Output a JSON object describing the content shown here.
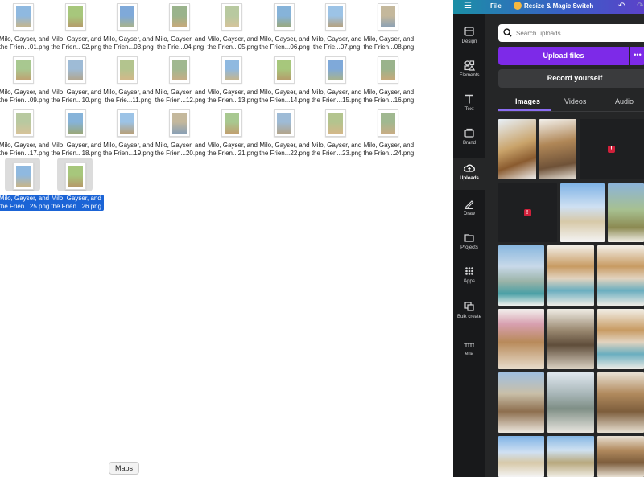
{
  "finder": {
    "files": [
      {
        "line1": "Milo, Gayser, and",
        "line2": "the Frien...01.png",
        "selected": false
      },
      {
        "line1": "Milo, Gayser, and",
        "line2": "the Frien...02.png",
        "selected": false
      },
      {
        "line1": "Milo, Gayser, and",
        "line2": "the Frien...03.png",
        "selected": false
      },
      {
        "line1": "Milo, Gayser, and",
        "line2": "the Frie...04.png",
        "selected": false
      },
      {
        "line1": "Milo, Gayser, and",
        "line2": "the Frien...05.png",
        "selected": false
      },
      {
        "line1": "Milo, Gayser, and",
        "line2": "the Frien...06.png",
        "selected": false
      },
      {
        "line1": "Milo, Gayser, and",
        "line2": "the Frie...07.png",
        "selected": false
      },
      {
        "line1": "Milo, Gayser, and",
        "line2": "the Frien...08.png",
        "selected": false
      },
      {
        "line1": "Milo, Gayser, and",
        "line2": "the Frien...09.png",
        "selected": false
      },
      {
        "line1": "Milo, Gayser, and",
        "line2": "the Frien...10.png",
        "selected": false
      },
      {
        "line1": "Milo, Gayser, and",
        "line2": "the Frie...11.png",
        "selected": false
      },
      {
        "line1": "Milo, Gayser, and",
        "line2": "the Frien...12.png",
        "selected": false
      },
      {
        "line1": "Milo, Gayser, and",
        "line2": "the Frien...13.png",
        "selected": false
      },
      {
        "line1": "Milo, Gayser, and",
        "line2": "the Frien...14.png",
        "selected": false
      },
      {
        "line1": "Milo, Gayser, and",
        "line2": "the Frien...15.png",
        "selected": false
      },
      {
        "line1": "Milo, Gayser, and",
        "line2": "the Frien...16.png",
        "selected": false
      },
      {
        "line1": "Milo, Gayser, and",
        "line2": "the Frien...17.png",
        "selected": false
      },
      {
        "line1": "Milo, Gayser, and",
        "line2": "the Frien...18.png",
        "selected": false
      },
      {
        "line1": "Milo, Gayser, and",
        "line2": "the Frien...19.png",
        "selected": false
      },
      {
        "line1": "Milo, Gayser, and",
        "line2": "the Frien...20.png",
        "selected": false
      },
      {
        "line1": "Milo, Gayser, and",
        "line2": "the Frien...21.png",
        "selected": false
      },
      {
        "line1": "Milo, Gayser, and",
        "line2": "the Frien...22.png",
        "selected": false
      },
      {
        "line1": "Milo, Gayser, and",
        "line2": "the Frien...23.png",
        "selected": false
      },
      {
        "line1": "Milo, Gayser, and",
        "line2": "the Frien...24.png",
        "selected": false
      },
      {
        "line1": "Milo, Gayser, and",
        "line2": "the Frien...25.png",
        "selected": true
      },
      {
        "line1": "Milo, Gayser, and",
        "line2": "the Frien...26.png",
        "selected": true
      }
    ],
    "tooltip": "Maps"
  },
  "canva": {
    "topbar": {
      "menu_icon": "hamburger-icon",
      "file_label": "File",
      "resize_label": "Resize & Magic Switch",
      "undo_icon": "undo-icon",
      "redo_icon": "redo-icon"
    },
    "rail": [
      {
        "label": "Design",
        "icon": "design-icon",
        "active": false
      },
      {
        "label": "Elements",
        "icon": "elements-icon",
        "active": false
      },
      {
        "label": "Text",
        "icon": "text-icon",
        "active": false
      },
      {
        "label": "Brand",
        "icon": "brand-icon",
        "active": false
      },
      {
        "label": "Uploads",
        "icon": "cloud-upload-icon",
        "active": true
      },
      {
        "label": "Draw",
        "icon": "draw-icon",
        "active": false
      },
      {
        "label": "Projects",
        "icon": "folder-icon",
        "active": false
      },
      {
        "label": "Apps",
        "icon": "apps-grid-icon",
        "active": false
      },
      {
        "label": "Bulk create",
        "icon": "bulk-create-icon",
        "active": false
      },
      {
        "label": "ena",
        "icon": "custom-app-icon",
        "active": false
      }
    ],
    "panel": {
      "search_placeholder": "Search uploads",
      "upload_label": "Upload files",
      "more_label": "•••",
      "record_label": "Record yourself",
      "tabs": [
        {
          "label": "Images",
          "active": true
        },
        {
          "label": "Videos",
          "active": false
        },
        {
          "label": "Audio",
          "active": false
        }
      ],
      "error_badge": "!"
    },
    "colors": {
      "accent": "#7d2ae8",
      "panel_bg": "#252627",
      "rail_bg": "#18191b",
      "selection_blue": "#1b64d6",
      "error_red": "#d0203a"
    }
  }
}
